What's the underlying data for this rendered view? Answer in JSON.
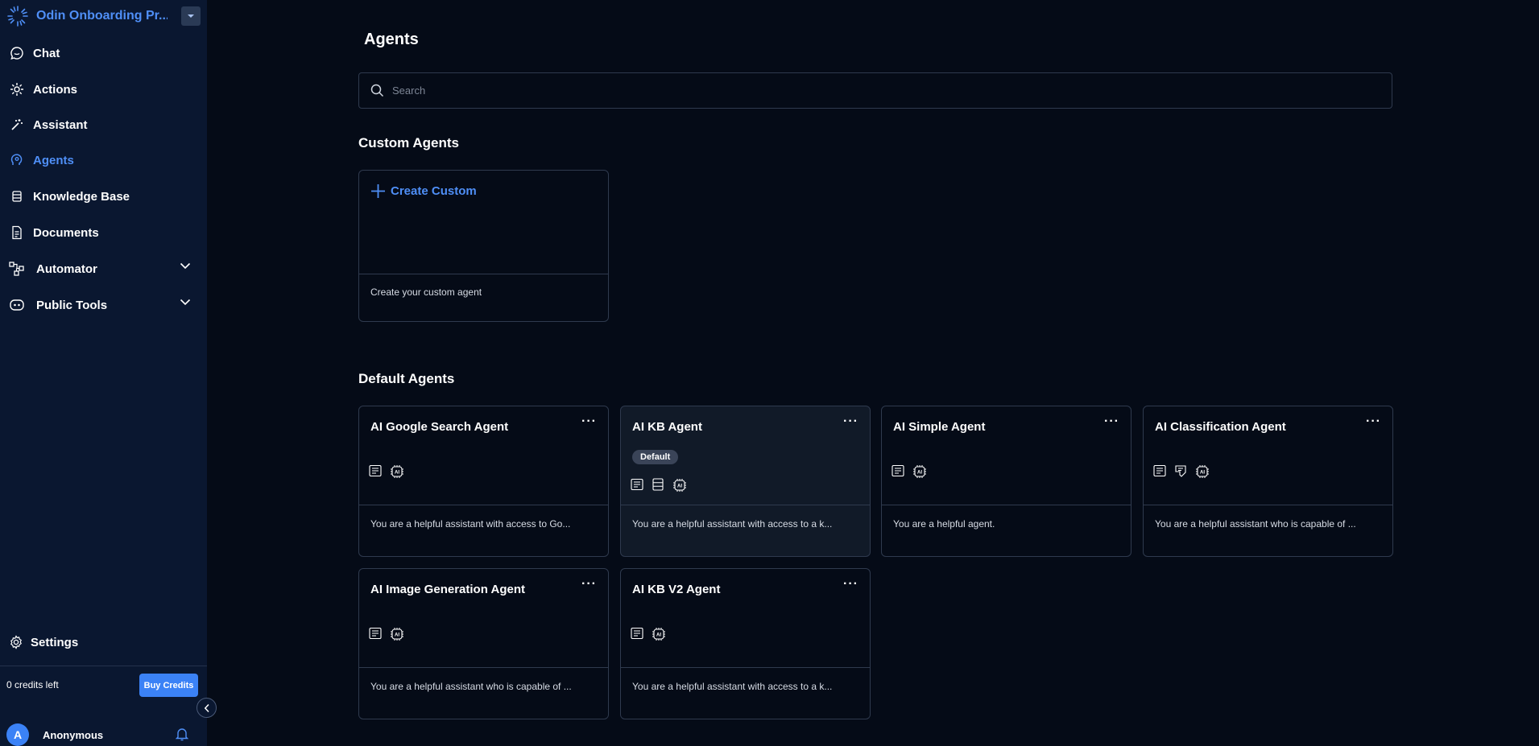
{
  "workspace": {
    "name": "Odin Onboarding Pr..."
  },
  "sidebar": {
    "items": [
      {
        "label": "Chat",
        "icon": "chat-icon"
      },
      {
        "label": "Actions",
        "icon": "actions-icon"
      },
      {
        "label": "Assistant",
        "icon": "magic-wand-icon"
      },
      {
        "label": "Agents",
        "icon": "agent-head-icon",
        "active": true
      },
      {
        "label": "Knowledge Base",
        "icon": "database-icon"
      },
      {
        "label": "Documents",
        "icon": "document-icon"
      },
      {
        "label": "Automator",
        "icon": "flow-icon",
        "expandable": true
      },
      {
        "label": "Public Tools",
        "icon": "robot-icon",
        "expandable": true
      }
    ],
    "settings_label": "Settings",
    "credits_text": "0 credits left",
    "buy_label": "Buy Credits",
    "user": {
      "initial": "A",
      "name": "Anonymous"
    }
  },
  "main": {
    "title": "Agents",
    "search": {
      "placeholder": "Search",
      "value": ""
    },
    "custom_section": "Custom Agents",
    "create_custom": {
      "label": "Create Custom",
      "desc": "Create your custom agent"
    },
    "default_section": "Default Agents",
    "agents": [
      {
        "title": "AI Google Search Agent",
        "desc": "You are a helpful assistant with access to Go...",
        "icons": [
          "document-icon",
          "ai-chip-icon"
        ]
      },
      {
        "title": "AI KB Agent",
        "badge": "Default",
        "desc": "You are a helpful assistant with access to a k...",
        "icons": [
          "document-icon",
          "database-icon",
          "ai-chip-icon"
        ],
        "selected": true
      },
      {
        "title": "AI Simple Agent",
        "desc": "You are a helpful agent.",
        "icons": [
          "document-icon",
          "ai-chip-icon"
        ]
      },
      {
        "title": "AI Classification Agent",
        "desc": "You are a helpful assistant who is capable of ...",
        "icons": [
          "document-icon",
          "tag-icon",
          "ai-chip-icon"
        ]
      },
      {
        "title": "AI Image Generation Agent",
        "desc": "You are a helpful assistant who is capable of ...",
        "icons": [
          "document-icon",
          "ai-chip-icon"
        ]
      },
      {
        "title": "AI KB V2 Agent",
        "desc": "You are a helpful assistant with access to a k...",
        "icons": [
          "document-icon",
          "ai-chip-icon"
        ]
      }
    ],
    "more_label": "···"
  },
  "colors": {
    "accent": "#4f8ff7",
    "sidebar_bg": "#0a1730",
    "main_bg": "#050b17",
    "border": "#2f3a4e"
  }
}
